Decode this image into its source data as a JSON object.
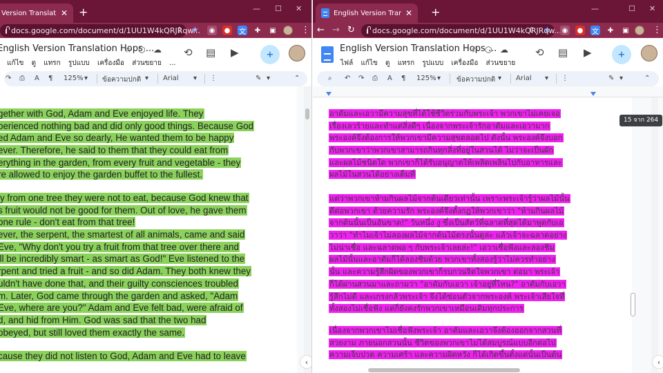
{
  "left": {
    "tab_title": "Version Translation Hops",
    "url": "docs.google.com/document/d/1UU1W4kQRJRqw...",
    "doc_title": "English Version Translation Hops ...",
    "menu": [
      "แก้ไข",
      "ดู",
      "แทรก",
      "รูปแบบ",
      "เครื่องมือ",
      "ส่วนขยาย",
      "..."
    ],
    "zoom": "125%",
    "style": "ข้อความปกติ",
    "font": "Arial",
    "paragraphs": [
      [
        "gether with God, Adam and Eve enjoyed life. They",
        "perienced nothing bad and did only good things. Because God",
        "ed Adam and Eve so dearly, He wanted them to be happy",
        "ever. Therefore, he said to them that they could eat from",
        "erything in the garden, from every fruit and vegetable - they",
        "re allowed to enjoy the garden buffet to the fullest."
      ],
      [
        "ly from one tree they were not to eat, because God knew that",
        "s fruit would not be good for them. Out of love, he gave them",
        "one rule - don't eat from that tree!",
        "ever, the serpent, the smartest of all animals, came and said",
        "Eve, \"Why don't you try a fruit from that tree over there and",
        "'ll be incredibly smart - as smart as God!\" Eve listened to the",
        "rpent and tried a fruit - and so did Adam. They both knew they",
        "uldn't have done that, and their guilty consciences troubled",
        "m. Later, God came through the garden and asked, \"Adam",
        "Eve, where are you?\" Adam and Eve felt bad, were afraid of",
        "d, and hid from Him. God was sad that the two had",
        "obeyed, but still loved them exactly the same."
      ],
      [
        "cause they did not listen to God, Adam and Eve had to leave"
      ]
    ]
  },
  "right": {
    "tab_title": "English Version Translation Hops",
    "url": "docs.google.com/document/d/1UU1W4kQRJRqw...",
    "doc_title": "English Version Translation Hops ...",
    "menu": [
      "ไฟล์",
      "แก้ไข",
      "ดู",
      "แทรก",
      "รูปแบบ",
      "เครื่องมือ",
      "ส่วนขยาย"
    ],
    "zoom": "125%",
    "style": "ข้อความปกติ",
    "font": "Arial",
    "page_indicator": "15 จาก 264",
    "paragraphs": [
      [
        "อาดัมและเอวามีความสุขที่ได้ใช้ชีวิตร่วมกับพระเจ้า พวกเขาไม่เคยเจอ",
        "เรื่องเลวร้ายและทำแต่สิ่งดีๆ เนื่องจากพระเจ้ารักอาดัมและเอวามาก",
        "พระองค์จึงต้องการให้พวกเขามีความสุขตลอดไป ดังนั้น พระองค์จึงบอก",
        "กับพวกเขาว่าพวกเขาสามารถกินทุกสิ่งที่อยู่ในสวนได้ ไม่ว่าจะเป็นผัก",
        "และผลไม้ชนิดใด พวกเขาก็ได้รับอนุญาตให้เพลิดเพลินไปกับอาหารและ",
        "ผลไม้ในสวนได้อย่างเต็มที่"
      ],
      [
        "แต่ว่าพวกเขาห้ามกินผลไม้จากต้นเดียวเท่านั้น เพราะพระเจ้ารู้ว่าผลไม้นั้น",
        "ดีต่อพวกเขา ด้วยความรัก พระองค์จึงตั้งกฎให้พวกเขาว่า \"ห้ามกินผลไม้",
        "จากต้นนั้นเป็นอันขาด!\" วันหนึ่ง งู ซึ่งเป็นสัตว์ที่ฉลาดที่สุดได้มาพูดกับเอ",
        "วาว่า \"ทำไมเจ้าไม่ลองผลไม้จากต้นไม้ตรงนั้นดูล่ะ แล้วเจ้าจะฉลาดอย่าง",
        "ไม่น่าเชื่อ และฉลาดพอ ๆ กับพระเจ้าเลยล่ะ!\" เอวาเชื่อฟังและลองชิม",
        "ผลไม้นั้นและอาดัมก็ได้ลองชิมด้วย พวกเขาทั้งสองรู้ว่าไม่ควรทำอย่าง",
        "นั้น และความรู้สึกผิดของพวกเขาก็รบกวนจิตใจพวกเขา ต่อมา พระเจ้า",
        "ก็ได้ผ่านสวนมาและถามว่า \"อาดัมกับเอวา เจ้าอยู่ที่ไหน?\" อาดัมกับเอวา",
        "รู้สึกไม่ดี และเกรงกลัวพระเจ้า จึงได้ซ่อนตัวจากพระองค์ พระเจ้าเสียใจที่",
        "ทั้งสองไม่เชื่อฟัง แต่ก็ยังคงรักพวกเขาเหมือนเดิมทุกประการ"
      ],
      [
        "เนื่องจากพวกเขาไม่เชื่อฟังพระเจ้า อาดัมและเอวาจึงต้องออกจากสวนที่",
        "สวยงาม ภายนอกสวนนั้น ชีวิตของพวกเขาไม่ได้สมบูรณ์แบบอีกต่อไป",
        "ความเจ็บปวด ความเศร้า และความผิดหวัง ก็ได้เกิดขึ้นตั้งแต่นั้นเป็นต้น"
      ]
    ]
  }
}
